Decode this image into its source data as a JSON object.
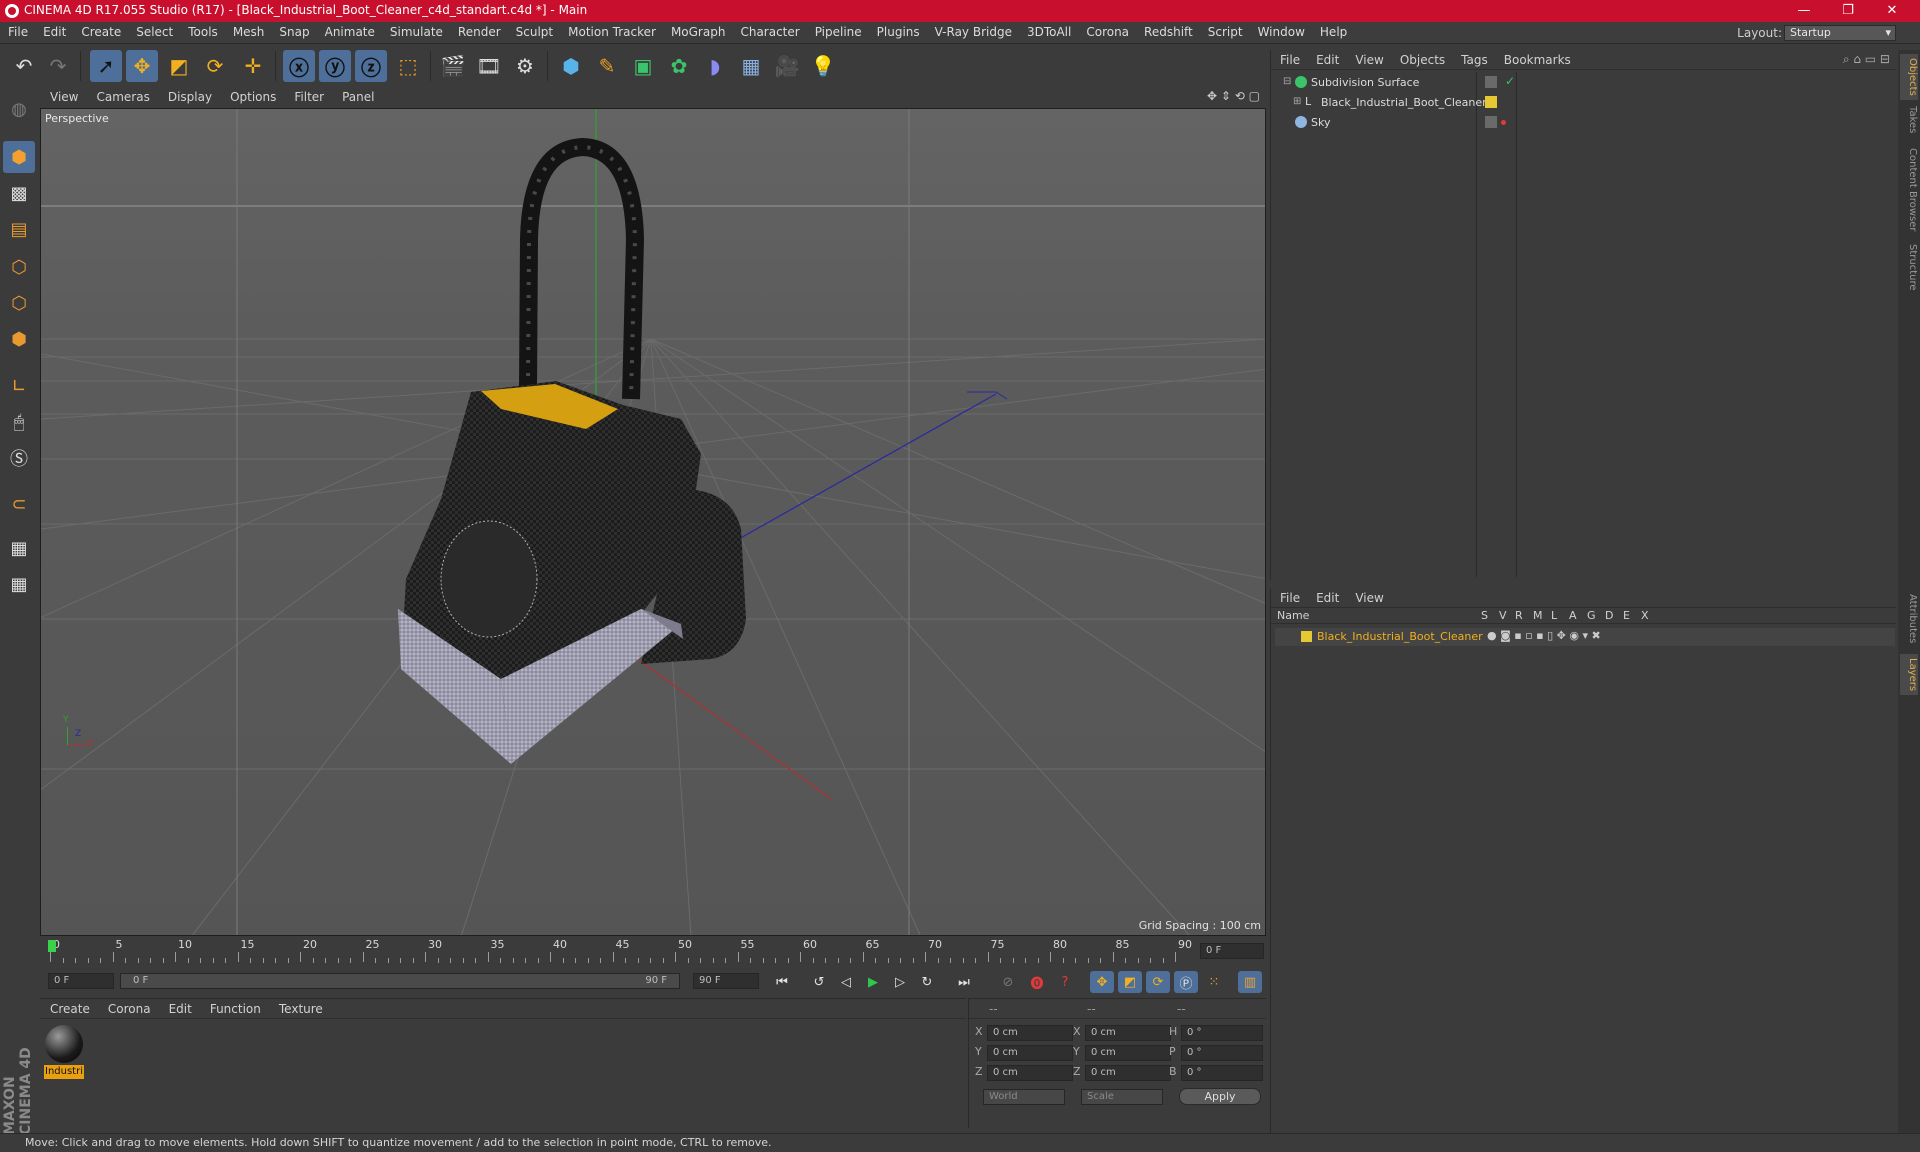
{
  "title_bar": {
    "text": "CINEMA 4D R17.055 Studio (R17) - [Black_Industrial_Boot_Cleaner_c4d_standart.c4d *] - Main",
    "minimize": "—",
    "maximize": "❐",
    "close": "✕"
  },
  "menu": [
    "File",
    "Edit",
    "Create",
    "Select",
    "Tools",
    "Mesh",
    "Snap",
    "Animate",
    "Simulate",
    "Render",
    "Sculpt",
    "Motion Tracker",
    "MoGraph",
    "Character",
    "Pipeline",
    "Plugins",
    "V-Ray Bridge",
    "3DToAll",
    "Corona",
    "Redshift",
    "Script",
    "Window",
    "Help"
  ],
  "layout": {
    "label": "Layout:",
    "value": "Startup"
  },
  "toolbar_icons": [
    "undo-icon",
    "redo-icon",
    "live-select-icon",
    "move-icon",
    "scale-icon",
    "rotate-icon",
    "recent-tool-icon",
    "x-axis-icon",
    "y-axis-icon",
    "z-axis-icon",
    "coordinate-system-icon",
    "render-view-icon",
    "render-picture-viewer-icon",
    "edit-render-settings-icon",
    "cube-icon",
    "pen-spline-icon",
    "subdivision-icon",
    "cloner-icon",
    "deformer-icon",
    "floor-icon",
    "camera-icon",
    "light-icon"
  ],
  "viewport": {
    "menu": [
      "View",
      "Cameras",
      "Display",
      "Options",
      "Filter",
      "Panel"
    ],
    "label": "Perspective",
    "grid_spacing": "Grid Spacing : 100 cm",
    "axis_x": "X",
    "axis_y": "Y",
    "axis_z": "Z"
  },
  "timeline": {
    "ticks": [
      "0",
      "5",
      "10",
      "15",
      "20",
      "25",
      "30",
      "35",
      "40",
      "45",
      "50",
      "55",
      "60",
      "65",
      "70",
      "75",
      "80",
      "85",
      "90"
    ],
    "current_frame": "0 F",
    "start_field": "0 F",
    "slider_start": "0 F",
    "slider_end": "90 F",
    "end_field": "90 F"
  },
  "material_panel": {
    "menu": [
      "Create",
      "Corona",
      "Edit",
      "Function",
      "Texture"
    ],
    "material_name": "Industri"
  },
  "coords": {
    "header": [
      "--",
      "--",
      "--"
    ],
    "rows": [
      {
        "a": "X",
        "av": "0 cm",
        "b": "X",
        "bv": "0 cm",
        "c": "H",
        "cv": "0 °"
      },
      {
        "a": "Y",
        "av": "0 cm",
        "b": "Y",
        "bv": "0 cm",
        "c": "P",
        "cv": "0 °"
      },
      {
        "a": "Z",
        "av": "0 cm",
        "b": "Z",
        "bv": "0 cm",
        "c": "B",
        "cv": "0 °"
      }
    ],
    "world": "World",
    "scale": "Scale",
    "apply": "Apply"
  },
  "object_manager": {
    "menu": [
      "File",
      "Edit",
      "View",
      "Objects",
      "Tags",
      "Bookmarks"
    ],
    "objects": [
      {
        "name": "Subdivision Surface"
      },
      {
        "name": "Black_Industrial_Boot_Cleaner"
      },
      {
        "name": "Sky"
      }
    ]
  },
  "layer_manager": {
    "menu": [
      "File",
      "Edit",
      "View"
    ],
    "columns": [
      "Name",
      "S",
      "V",
      "R",
      "M",
      "L",
      "A",
      "G",
      "D",
      "E",
      "X"
    ],
    "layers": [
      {
        "name": "Black_Industrial_Boot_Cleaner",
        "color": "#e6c832"
      }
    ]
  },
  "right_tabs": [
    "Objects",
    "Takes",
    "Content Browser",
    "Structure",
    "Attributes",
    "Layers"
  ],
  "status": "Move: Click and drag to move elements. Hold down SHIFT to quantize movement / add to the selection in point mode, CTRL to remove.",
  "brand": "MAXON CINEMA 4D",
  "colors": {
    "titlebar": "#c8102e",
    "selected": "#4d6f99",
    "layer": "#e6c832"
  }
}
